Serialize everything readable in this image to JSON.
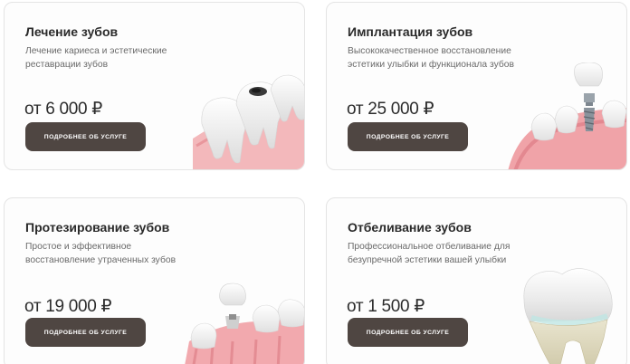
{
  "services": [
    {
      "title": "Лечение зубов",
      "description": "Лечение кариеса и эстетические реставрации зубов",
      "price": "от 6 000 ₽",
      "button_label": "ПОДРОБНЕЕ ОБ УСЛУГЕ",
      "image": "teeth-with-caries-illustration"
    },
    {
      "title": "Имплантация зубов",
      "description": "Высококачественное восстановление эстетики улыбки и функционала зубов",
      "price": "от 25 000 ₽",
      "button_label": "ПОДРОБНЕЕ ОБ УСЛУГЕ",
      "image": "dental-implant-illustration"
    },
    {
      "title": "Протезирование зубов",
      "description": "Простое и эффективное восстановление утраченных зубов",
      "price": "от 19 000 ₽",
      "button_label": "ПОДРОБНЕЕ ОБ УСЛУГЕ",
      "image": "dental-crown-illustration"
    },
    {
      "title": "Отбеливание зубов",
      "description": "Профессиональное отбеливание для безупречной эстетики вашей улыбки",
      "price": "от 1 500 ₽",
      "button_label": "ПОДРОБНЕЕ ОБ УСЛУГЕ",
      "image": "white-tooth-illustration"
    }
  ],
  "colors": {
    "button_bg": "#4f4642",
    "button_text": "#ffffff",
    "card_border": "#e4e4e4",
    "gum_pink": "#f2a7ad",
    "tooth_white": "#f3f1ee"
  }
}
